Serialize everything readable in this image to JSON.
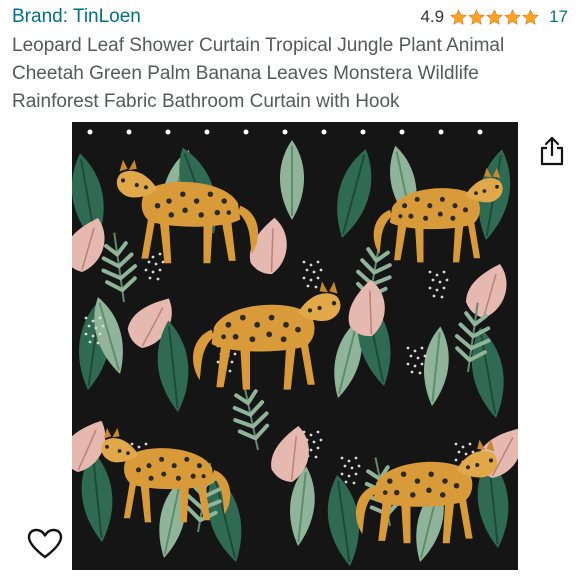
{
  "product": {
    "brand": "Brand: TinLoen",
    "rating": "4.9",
    "rating_stars": 4.9,
    "review_count": "17",
    "title": "Leopard Leaf Shower Curtain Tropical Jungle Plant Animal Cheetah Green Palm Banana Leaves Monstera Wildlife Rainforest Fabric Bathroom Curtain with Hook"
  },
  "icons": {
    "star": "star-icon",
    "share": "share-icon",
    "favorite": "heart-outline-icon"
  },
  "colors": {
    "link": "#007185",
    "star": "#FFA41C",
    "title": "#565959",
    "curtain_background": "#151515",
    "leaf_dark": "#2F6B52",
    "leaf_light": "#8FB49A",
    "leaf_pink": "#E5B8B0",
    "cheetah": "#D99A3A"
  }
}
